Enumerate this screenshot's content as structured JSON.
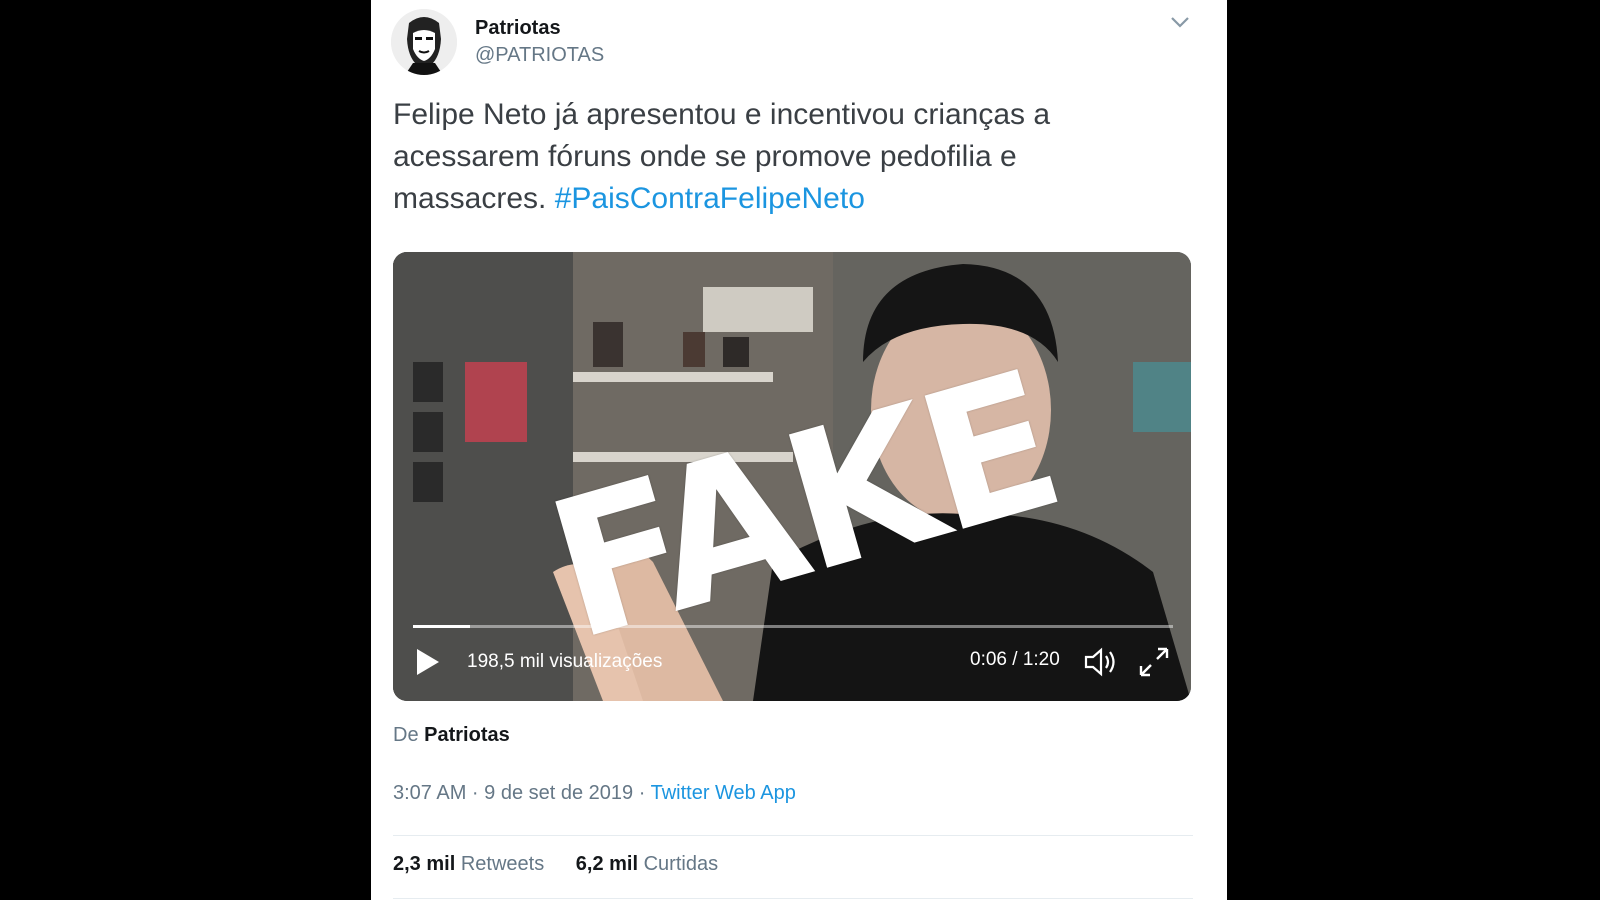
{
  "author": {
    "name": "Patriotas",
    "handle": "@PATRIOTAS"
  },
  "tweet": {
    "text": "Felipe Neto já apresentou e incentivou crianças a acessarem fóruns onde se promove pedofilia e massacres. ",
    "hashtag": "#PaisContraFelipeNeto"
  },
  "video": {
    "overlay_text": "FAKE",
    "views": "198,5 mil visualizações",
    "time": "0:06 / 1:20",
    "progress_fraction": 0.075
  },
  "attribution": {
    "prefix": "De",
    "name": "Patriotas"
  },
  "meta": {
    "timestamp": "3:07 AM · 9 de set de 2019 · ",
    "source": "Twitter Web App"
  },
  "stats": {
    "retweets_count": "2,3 mil",
    "retweets_label": "Retweets",
    "likes_count": "6,2 mil",
    "likes_label": "Curtidas"
  },
  "colors": {
    "link": "#1b95e0",
    "secondary_text": "#657786",
    "primary_text": "#14171a"
  },
  "icons": [
    "chevron-down-icon",
    "play-icon",
    "volume-icon",
    "fullscreen-icon"
  ]
}
